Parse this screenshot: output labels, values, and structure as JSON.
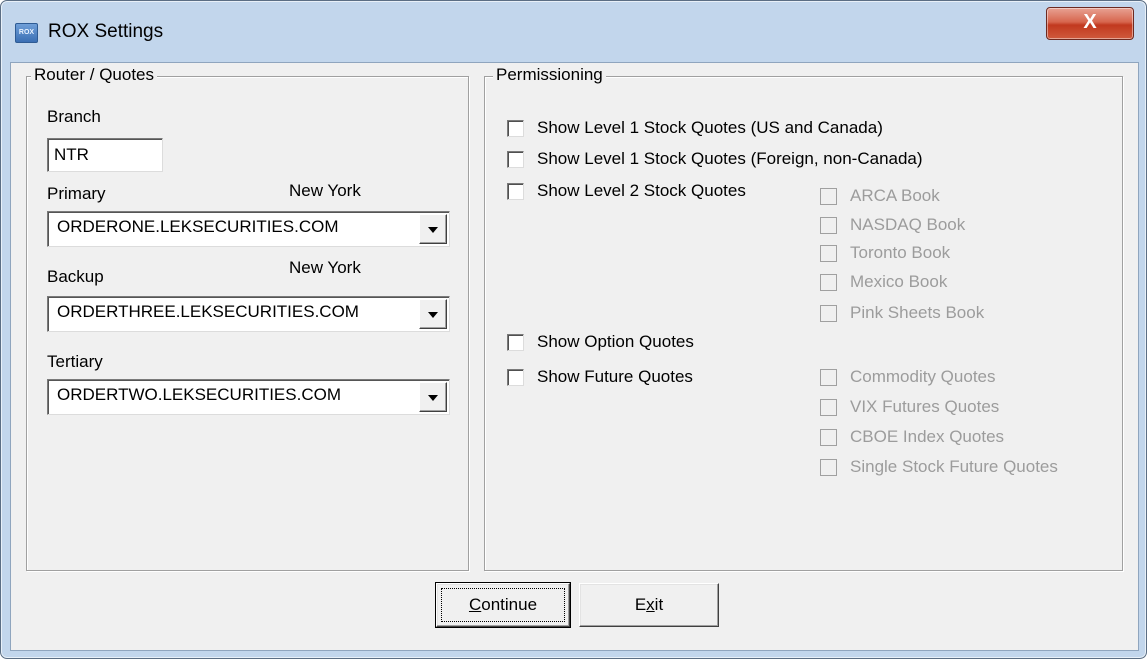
{
  "window": {
    "title": "ROX Settings",
    "icon_text": "ROX",
    "close_glyph": "X"
  },
  "router": {
    "legend": "Router / Quotes",
    "branch_label": "Branch",
    "branch_value": "NTR",
    "primary_label": "Primary",
    "primary_location": "New York",
    "primary_value": "ORDERONE.LEKSECURITIES.COM",
    "backup_label": "Backup",
    "backup_location": "New York",
    "backup_value": "ORDERTHREE.LEKSECURITIES.COM",
    "tertiary_label": "Tertiary",
    "tertiary_value": "ORDERTWO.LEKSECURITIES.COM"
  },
  "perm": {
    "legend": "Permissioning",
    "level1_us": "Show Level 1 Stock Quotes (US and Canada)",
    "level1_foreign": "Show Level 1 Stock Quotes (Foreign, non-Canada)",
    "level2": "Show Level 2 Stock Quotes",
    "arca": "ARCA Book",
    "nasdaq": "NASDAQ Book",
    "toronto": "Toronto Book",
    "mexico": "Mexico Book",
    "pink": "Pink Sheets Book",
    "options": "Show Option Quotes",
    "futures": "Show Future Quotes",
    "commodity": "Commodity Quotes",
    "vix": "VIX Futures Quotes",
    "cboe": "CBOE Index Quotes",
    "single_stock": "Single Stock Future Quotes"
  },
  "buttons": {
    "continue_first": "C",
    "continue_rest": "ontinue",
    "exit_first": "E",
    "exit_underlined": "x",
    "exit_rest": "it"
  }
}
